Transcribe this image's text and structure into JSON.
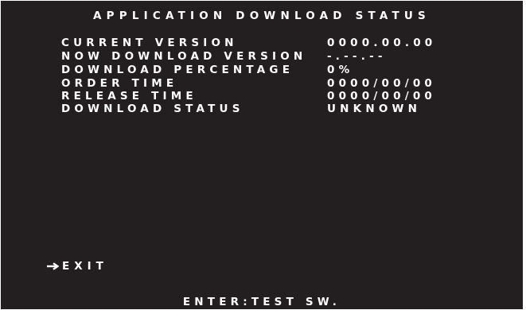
{
  "screen": {
    "title": "APPLICATION DOWNLOAD STATUS",
    "rows": [
      {
        "label": "CURRENT VERSION",
        "value": "0000.00.00"
      },
      {
        "label": "NOW DOWNLOAD VERSION",
        "value": "-.--.--"
      },
      {
        "label": "DOWNLOAD PERCENTAGE",
        "value": "0%"
      },
      {
        "label": "ORDER TIME",
        "value": "0000/00/00"
      },
      {
        "label": "RELEASE TIME",
        "value": "0000/00/00"
      },
      {
        "label": "DOWNLOAD STATUS",
        "value": "UNKNOWN"
      }
    ],
    "exit_label": "EXIT",
    "footer": "ENTER:TEST SW."
  },
  "colors": {
    "background": "#231f20",
    "text": "#ffffff"
  },
  "icons": {
    "cursor": "right-arrow-icon"
  }
}
